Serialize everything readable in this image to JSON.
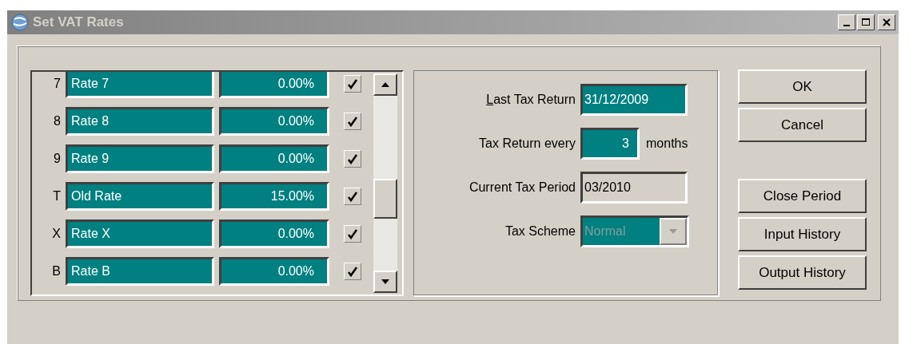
{
  "window": {
    "title": "Set VAT Rates"
  },
  "rates": [
    {
      "code": "7",
      "name": "Rate 7",
      "rate": "0.00%",
      "checked": true
    },
    {
      "code": "8",
      "name": "Rate 8",
      "rate": "0.00%",
      "checked": true
    },
    {
      "code": "9",
      "name": "Rate 9",
      "rate": "0.00%",
      "checked": true
    },
    {
      "code": "T",
      "name": "Old Rate",
      "rate": "15.00%",
      "checked": true
    },
    {
      "code": "X",
      "name": "Rate X",
      "rate": "0.00%",
      "checked": true
    },
    {
      "code": "B",
      "name": "Rate B",
      "rate": "0.00%",
      "checked": true
    }
  ],
  "settings": [
    {
      "kind": "field",
      "label": "Last Tax Return",
      "accelerator": true,
      "value": "31/12/2009",
      "editable": true
    },
    {
      "kind": "field",
      "label": "Tax Return every",
      "value": "3",
      "editable": true,
      "suffix": "months"
    },
    {
      "kind": "field",
      "label": "Current Tax Period",
      "value": "03/2010",
      "editable": false
    },
    {
      "kind": "combo",
      "label": "Tax Scheme",
      "value": "Normal",
      "disabled": true
    }
  ],
  "buttons_top": [
    "OK",
    "Cancel"
  ],
  "buttons_bottom": [
    "Close Period",
    "Input History",
    "Output History"
  ]
}
